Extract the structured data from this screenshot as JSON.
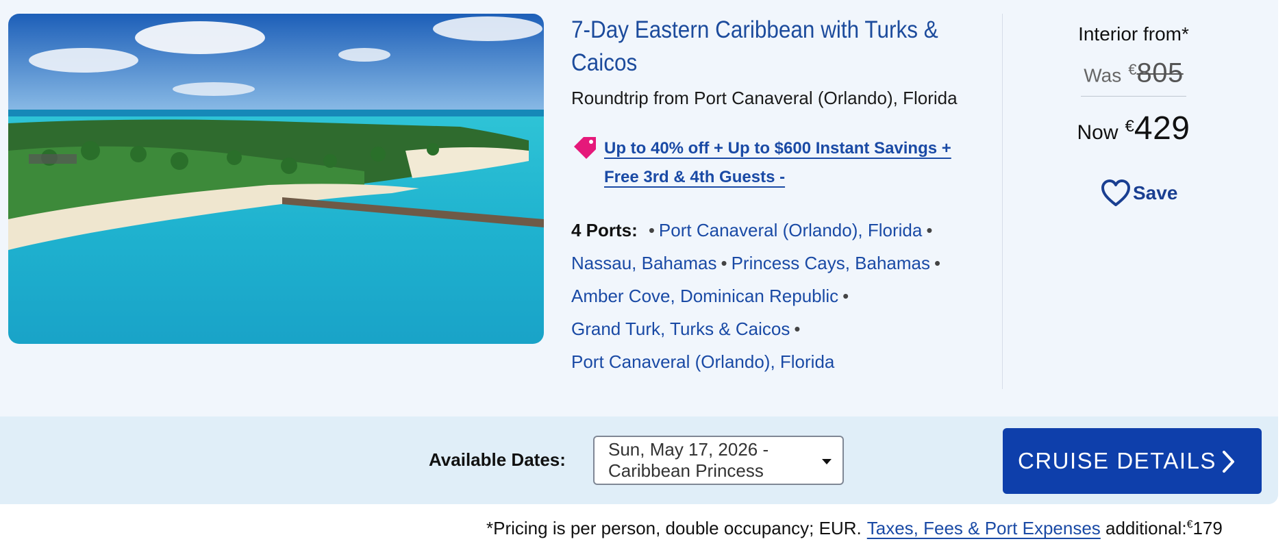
{
  "cruise": {
    "title": "7-Day Eastern Caribbean with Turks & Caicos",
    "subtitle": "Roundtrip from Port Canaveral (Orlando), Florida",
    "promo_text": "Up to 40% off + Up to $600 Instant Savings + Free 3rd & 4th Guests -",
    "ports_label": "4 Ports:",
    "ports": [
      "Port Canaveral (Orlando), Florida",
      "Nassau, Bahamas",
      "Princess Cays, Bahamas",
      "Amber Cove, Dominican Republic",
      "Grand Turk, Turks & Caicos",
      "Port Canaveral (Orlando), Florida"
    ],
    "bullet": "•"
  },
  "pricing": {
    "label": "Interior from*",
    "was_label": "Was",
    "was_currency": "€",
    "was_amount": "805",
    "now_label": "Now",
    "now_currency": "€",
    "now_amount": "429",
    "save_label": "Save"
  },
  "booking": {
    "dates_label": "Available Dates:",
    "selected_date": "Sun, May 17, 2026 - Caribbean Princess",
    "details_button": "CRUISE DETAILS"
  },
  "footnote": {
    "text": "*Pricing is per person, double occupancy; EUR.",
    "link": "Taxes, Fees & Port Expenses",
    "additional": "additional:",
    "currency": "€",
    "amount": "179"
  },
  "icons": {
    "promo": "tag-icon",
    "save": "heart-icon",
    "select": "caret-down-icon",
    "button": "chevron-right-icon"
  },
  "colors": {
    "accent": "#1a4aa5",
    "button": "#0e3fab",
    "tag": "#e5197a",
    "card_bg": "#f1f6fc",
    "band_bg": "#e0eef8"
  }
}
